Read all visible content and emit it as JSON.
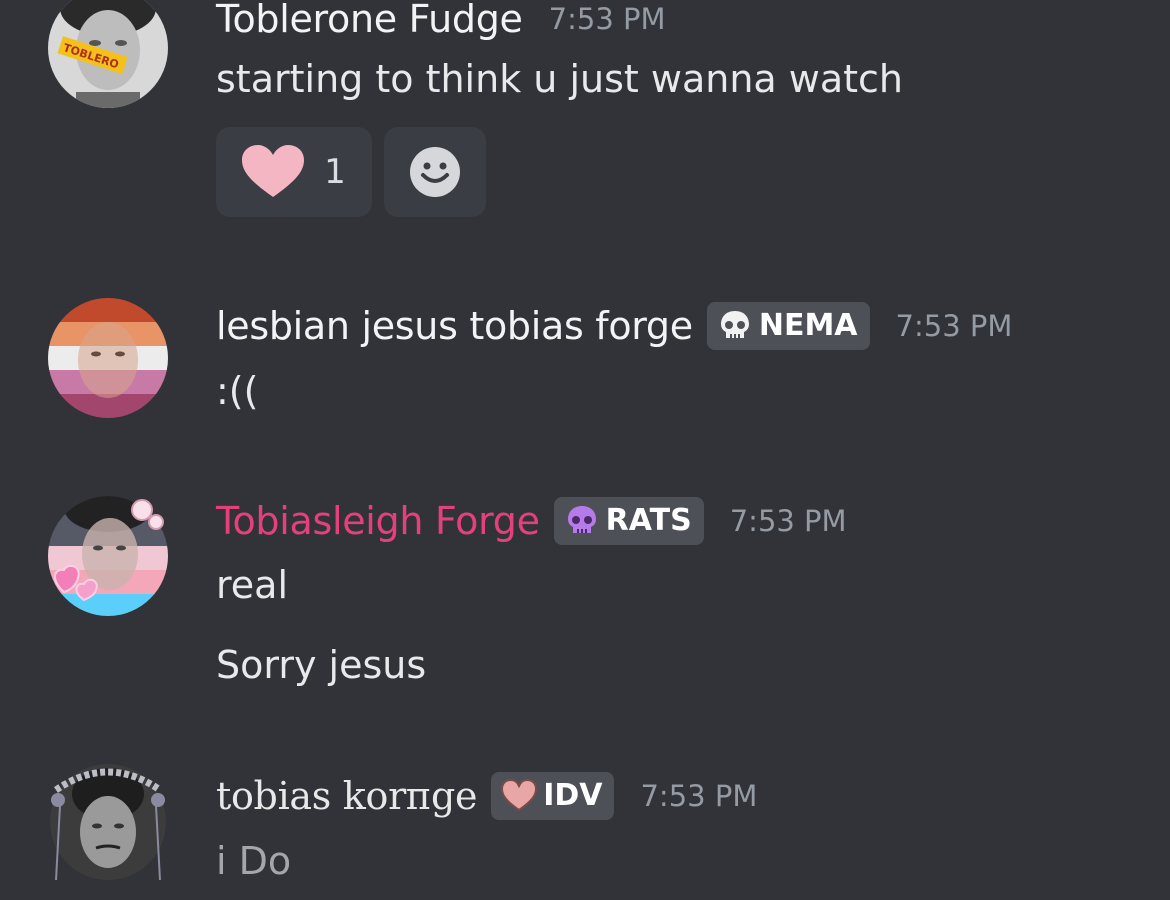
{
  "messages": [
    {
      "username": "Toblerone Fudge",
      "timestamp": "7:53 PM",
      "lines": [
        "starting to think u just wanna watch"
      ],
      "avatar_label": "TOBLERO",
      "reactions": [
        {
          "icon": "heart-icon",
          "count": "1"
        },
        {
          "icon": "add-reaction-icon"
        }
      ]
    },
    {
      "username": "lesbian jesus tobias forge",
      "tag": {
        "icon": "skull-icon",
        "label": "NEMA"
      },
      "timestamp": "7:53 PM",
      "lines": [
        ":(("
      ]
    },
    {
      "username": "Tobiasleigh Forge",
      "name_color": "#e4417a",
      "tag": {
        "icon": "purple-skull-icon",
        "label": "RATS"
      },
      "timestamp": "7:53 PM",
      "lines": [
        "real",
        "Sorry jesus"
      ]
    },
    {
      "username": "tobias korпge",
      "tag": {
        "icon": "pink-heart-icon",
        "label": "IDV"
      },
      "timestamp": "7:53 PM",
      "lines": [
        "i Do"
      ]
    }
  ],
  "colors": {
    "background": "#313338",
    "tag_background": "#4e5058",
    "timestamp": "#949ba4",
    "heart": "#f4b6c2"
  }
}
